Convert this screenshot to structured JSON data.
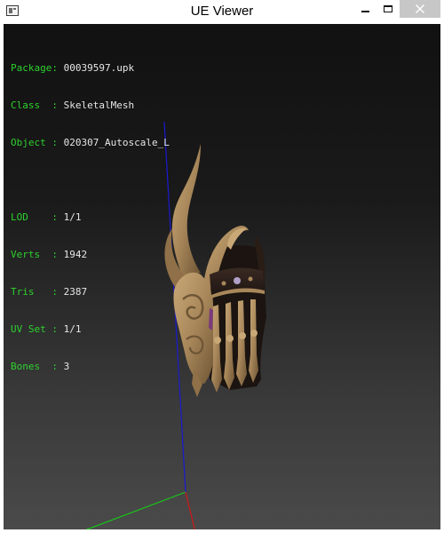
{
  "window": {
    "title": "UE Viewer"
  },
  "info": {
    "package": {
      "label": "Package:",
      "value": "00039597.upk"
    },
    "class": {
      "label": "Class  :",
      "value": "SkeletalMesh"
    },
    "object": {
      "label": "Object :",
      "value": "020307_Autoscale_L"
    },
    "lod": {
      "label": "LOD    :",
      "value": "1/1"
    },
    "verts": {
      "label": "Verts  :",
      "value": "1942"
    },
    "tris": {
      "label": "Tris   :",
      "value": "2387"
    },
    "uvset": {
      "label": "UV Set :",
      "value": "1/1"
    },
    "bones": {
      "label": "Bones  :",
      "value": "3"
    }
  },
  "colors": {
    "label_green": "#2ed12e",
    "value_text": "#e6e6e6",
    "axis_x": "#d01818",
    "axis_y": "#18c818",
    "axis_z": "#1a1ad0",
    "mesh_main": "#a8875a"
  },
  "icons": [
    "app-icon",
    "minimize-icon",
    "maximize-icon",
    "close-icon"
  ]
}
